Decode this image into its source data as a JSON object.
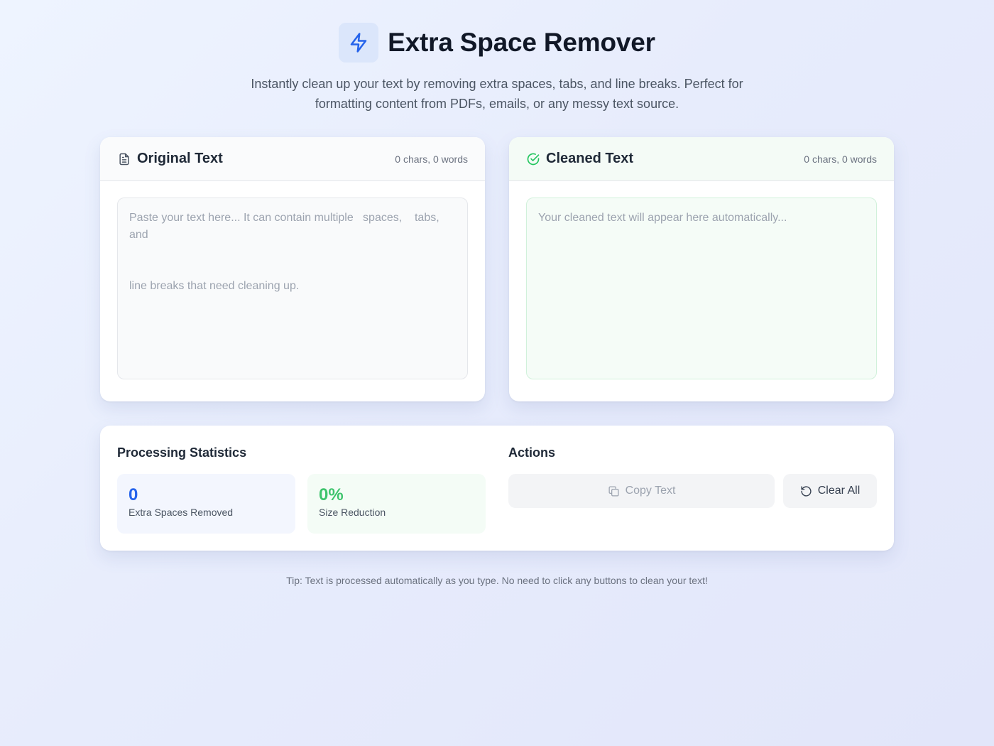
{
  "header": {
    "title": "Extra Space Remover",
    "subtitle": "Instantly clean up your text by removing extra spaces, tabs, and line breaks. Perfect for formatting content from PDFs, emails, or any messy text source.",
    "logo_icon": "lightning-bolt-icon"
  },
  "original": {
    "title": "Original Text",
    "count": "0 chars, 0 words",
    "icon": "document-icon",
    "placeholder_line1": "Paste your text here... It can contain multiple   spaces,    tabs, and",
    "placeholder_line2": "line breaks that need cleaning up.",
    "value": ""
  },
  "cleaned": {
    "title": "Cleaned Text",
    "count": "0 chars, 0 words",
    "icon": "check-circle-icon",
    "placeholder": "Your cleaned text will appear here automatically...",
    "value": ""
  },
  "stats": {
    "title": "Processing Statistics",
    "spaces_removed_value": "0",
    "spaces_removed_label": "Extra Spaces Removed",
    "size_reduction_value": "0%",
    "size_reduction_label": "Size Reduction"
  },
  "actions": {
    "title": "Actions",
    "copy_label": "Copy Text",
    "clear_label": "Clear All",
    "copy_icon": "copy-icon",
    "clear_icon": "reset-icon"
  },
  "tip": "Tip: Text is processed automatically as you type. No need to click any buttons to clean your text!",
  "colors": {
    "accent_blue": "#2563eb",
    "accent_green": "#22c55e",
    "logo_bg": "#dbe6fb"
  }
}
